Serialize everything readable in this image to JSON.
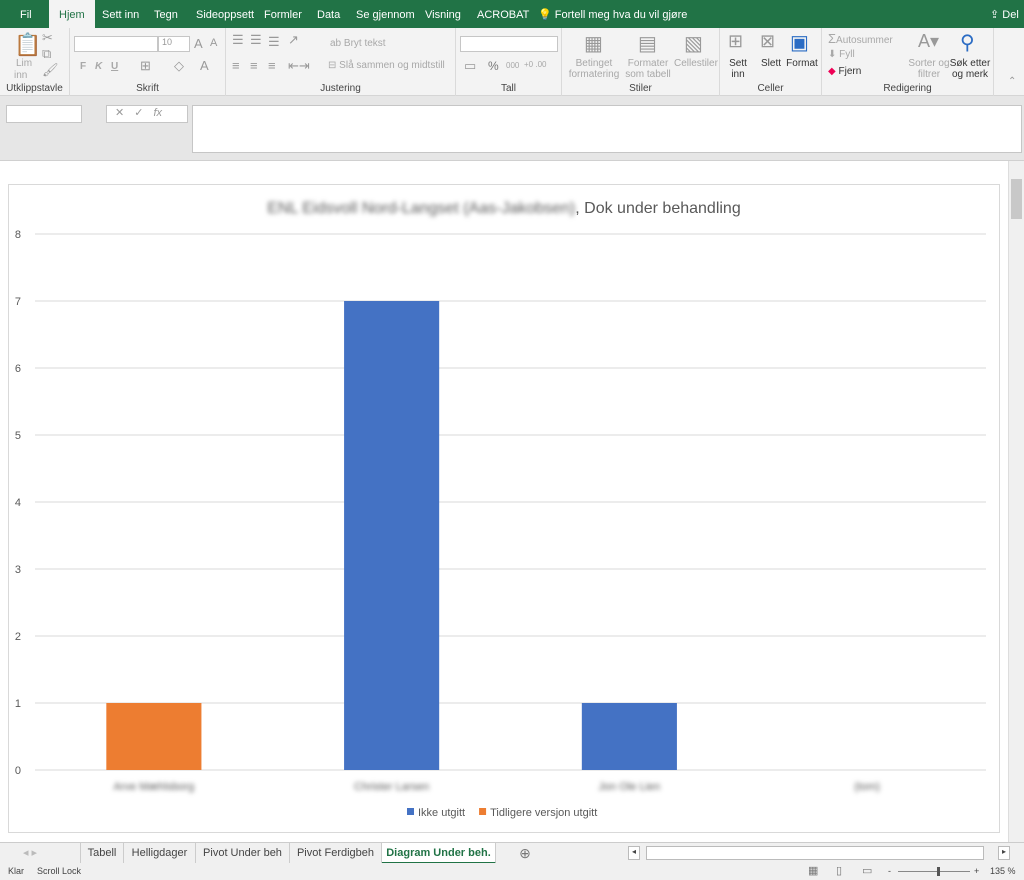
{
  "ribbon_tabs": [
    "Fil",
    "Hjem",
    "Sett inn",
    "Tegn",
    "Sideoppsett",
    "Formler",
    "Data",
    "Se gjennom",
    "Visning",
    "ACROBAT"
  ],
  "active_tab": "Hjem",
  "tell_me": "Fortell meg hva du vil gjøre",
  "share": "Del",
  "ribbon": {
    "clipboard": {
      "paste": "Lim",
      "paste2": "inn",
      "label": "Utklippstavle"
    },
    "font": {
      "size": "10",
      "bold": "F",
      "italic": "K",
      "underline": "U",
      "label": "Skrift"
    },
    "alignment": {
      "wrap": "Bryt tekst",
      "merge": "Slå sammen og midtstill",
      "label": "Justering"
    },
    "number": {
      "percent": "%",
      "thousands": "000",
      "label": "Tall"
    },
    "styles": {
      "conditional": "Betinget",
      "conditional2": "formatering",
      "table": "Formater",
      "table2": "som tabell",
      "cell": "Cellestiler",
      "label": "Stiler"
    },
    "cells": {
      "insert": "Sett",
      "insert2": "inn",
      "delete": "Slett",
      "format": "Format",
      "label": "Celler"
    },
    "editing": {
      "autosum": "Autosummer",
      "fill": "Fyll",
      "clear": "Fjern",
      "sort": "Sorter og",
      "sort2": "filtrer",
      "find": "Søk etter",
      "find2": "og merk",
      "label": "Redigering"
    }
  },
  "formula_bar": {
    "name_box": "",
    "fx": "fx",
    "formula": ""
  },
  "chart_data": {
    "type": "bar",
    "stacked": true,
    "title_redacted": "ENL Eidsvoll Nord-Langset (Aas-Jakobsen)",
    "title": ", Dok under behandling",
    "categories": [
      "Arve Mæhlsborg",
      "Christer Larsen",
      "Jon Ole Lien",
      "(tom)"
    ],
    "series": [
      {
        "name": "Ikke utgitt",
        "values": [
          0,
          7,
          1,
          0
        ],
        "color": "#4472c4"
      },
      {
        "name": "Tidligere versjon utgitt",
        "values": [
          1,
          0,
          0,
          0
        ],
        "color": "#ed7d31"
      }
    ],
    "ylim": [
      0,
      8
    ],
    "yticks": [
      "0",
      "1",
      "2",
      "3",
      "4",
      "5",
      "6",
      "7",
      "8"
    ],
    "grid": true,
    "legend": "bottom"
  },
  "sheet_tabs": [
    "Tabell",
    "Helligdager",
    "Pivot Under beh",
    "Pivot Ferdigbeh",
    "Diagram Under beh."
  ],
  "active_sheet": "Diagram Under beh.",
  "status": {
    "ready": "Klar",
    "scroll_lock": "Scroll Lock",
    "zoom": "135 %"
  }
}
